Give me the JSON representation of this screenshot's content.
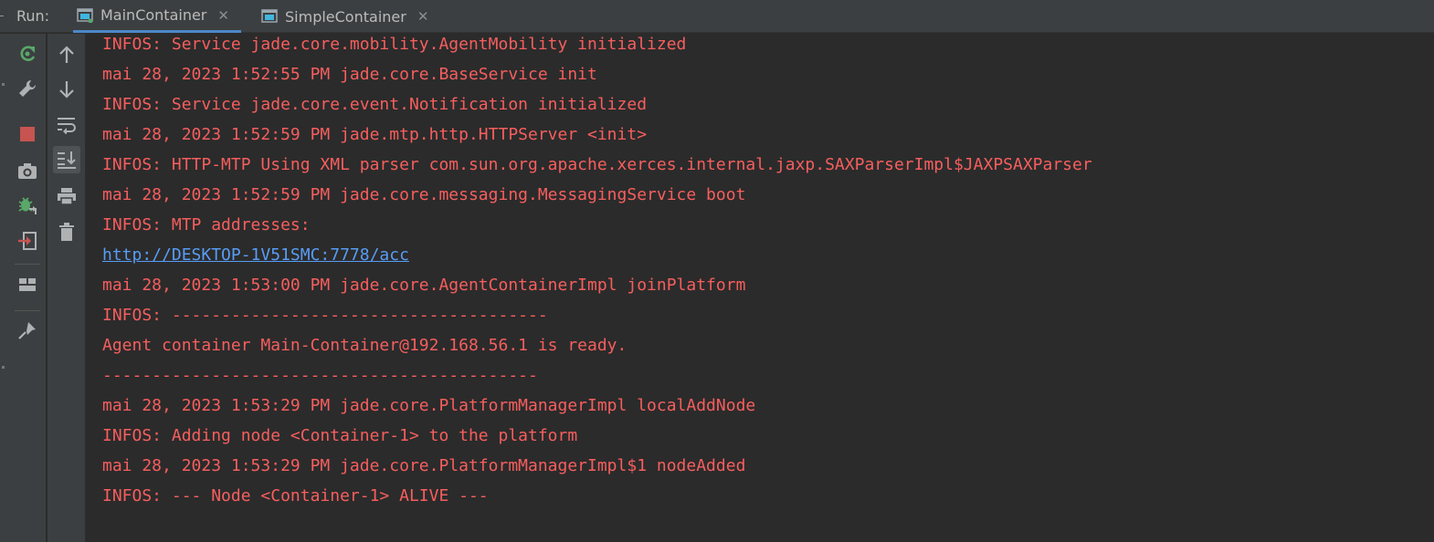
{
  "run_label": "Run:",
  "tabs": [
    {
      "label": "MainContainer",
      "close": "✕",
      "active": true
    },
    {
      "label": "SimpleContainer",
      "close": "✕",
      "active": false
    }
  ],
  "colors": {
    "error_text": "#f75e5e",
    "link_text": "#589df6",
    "active_tab_underline": "#4a88c7",
    "stop_button": "#c75450",
    "rerun_icon": "#59a869"
  },
  "toolbar_left": [
    "rerun-icon",
    "wrench-icon",
    "stop-icon",
    "camera-icon",
    "debug-icon",
    "exit-icon",
    "layout-icon",
    "pin-icon"
  ],
  "toolbar_right": [
    "arrow-up-icon",
    "arrow-down-icon",
    "soft-wrap-icon",
    "scroll-to-end-icon",
    "print-icon",
    "trash-icon"
  ],
  "console": {
    "lines": [
      {
        "text": "INFOS: Service jade.core.mobility.AgentMobility initialized",
        "type": "error"
      },
      {
        "text": "mai 28, 2023 1:52:55 PM jade.core.BaseService init",
        "type": "error"
      },
      {
        "text": "INFOS: Service jade.core.event.Notification initialized",
        "type": "error"
      },
      {
        "text": "mai 28, 2023 1:52:59 PM jade.mtp.http.HTTPServer <init>",
        "type": "error"
      },
      {
        "text": "INFOS: HTTP-MTP Using XML parser com.sun.org.apache.xerces.internal.jaxp.SAXParserImpl$JAXPSAXParser",
        "type": "error"
      },
      {
        "text": "mai 28, 2023 1:52:59 PM jade.core.messaging.MessagingService boot",
        "type": "error"
      },
      {
        "text": "INFOS: MTP addresses:",
        "type": "error"
      },
      {
        "text": "http://DESKTOP-1V51SMC:7778/acc",
        "type": "link"
      },
      {
        "text": "mai 28, 2023 1:53:00 PM jade.core.AgentContainerImpl joinPlatform",
        "type": "error"
      },
      {
        "text": "INFOS: --------------------------------------",
        "type": "error"
      },
      {
        "text": "Agent container Main-Container@192.168.56.1 is ready.",
        "type": "error"
      },
      {
        "text": "--------------------------------------------",
        "type": "error"
      },
      {
        "text": "mai 28, 2023 1:53:29 PM jade.core.PlatformManagerImpl localAddNode",
        "type": "error"
      },
      {
        "text": "INFOS: Adding node <Container-1> to the platform",
        "type": "error"
      },
      {
        "text": "mai 28, 2023 1:53:29 PM jade.core.PlatformManagerImpl$1 nodeAdded",
        "type": "error"
      },
      {
        "text": "INFOS: --- Node <Container-1> ALIVE ---",
        "type": "error"
      }
    ]
  }
}
